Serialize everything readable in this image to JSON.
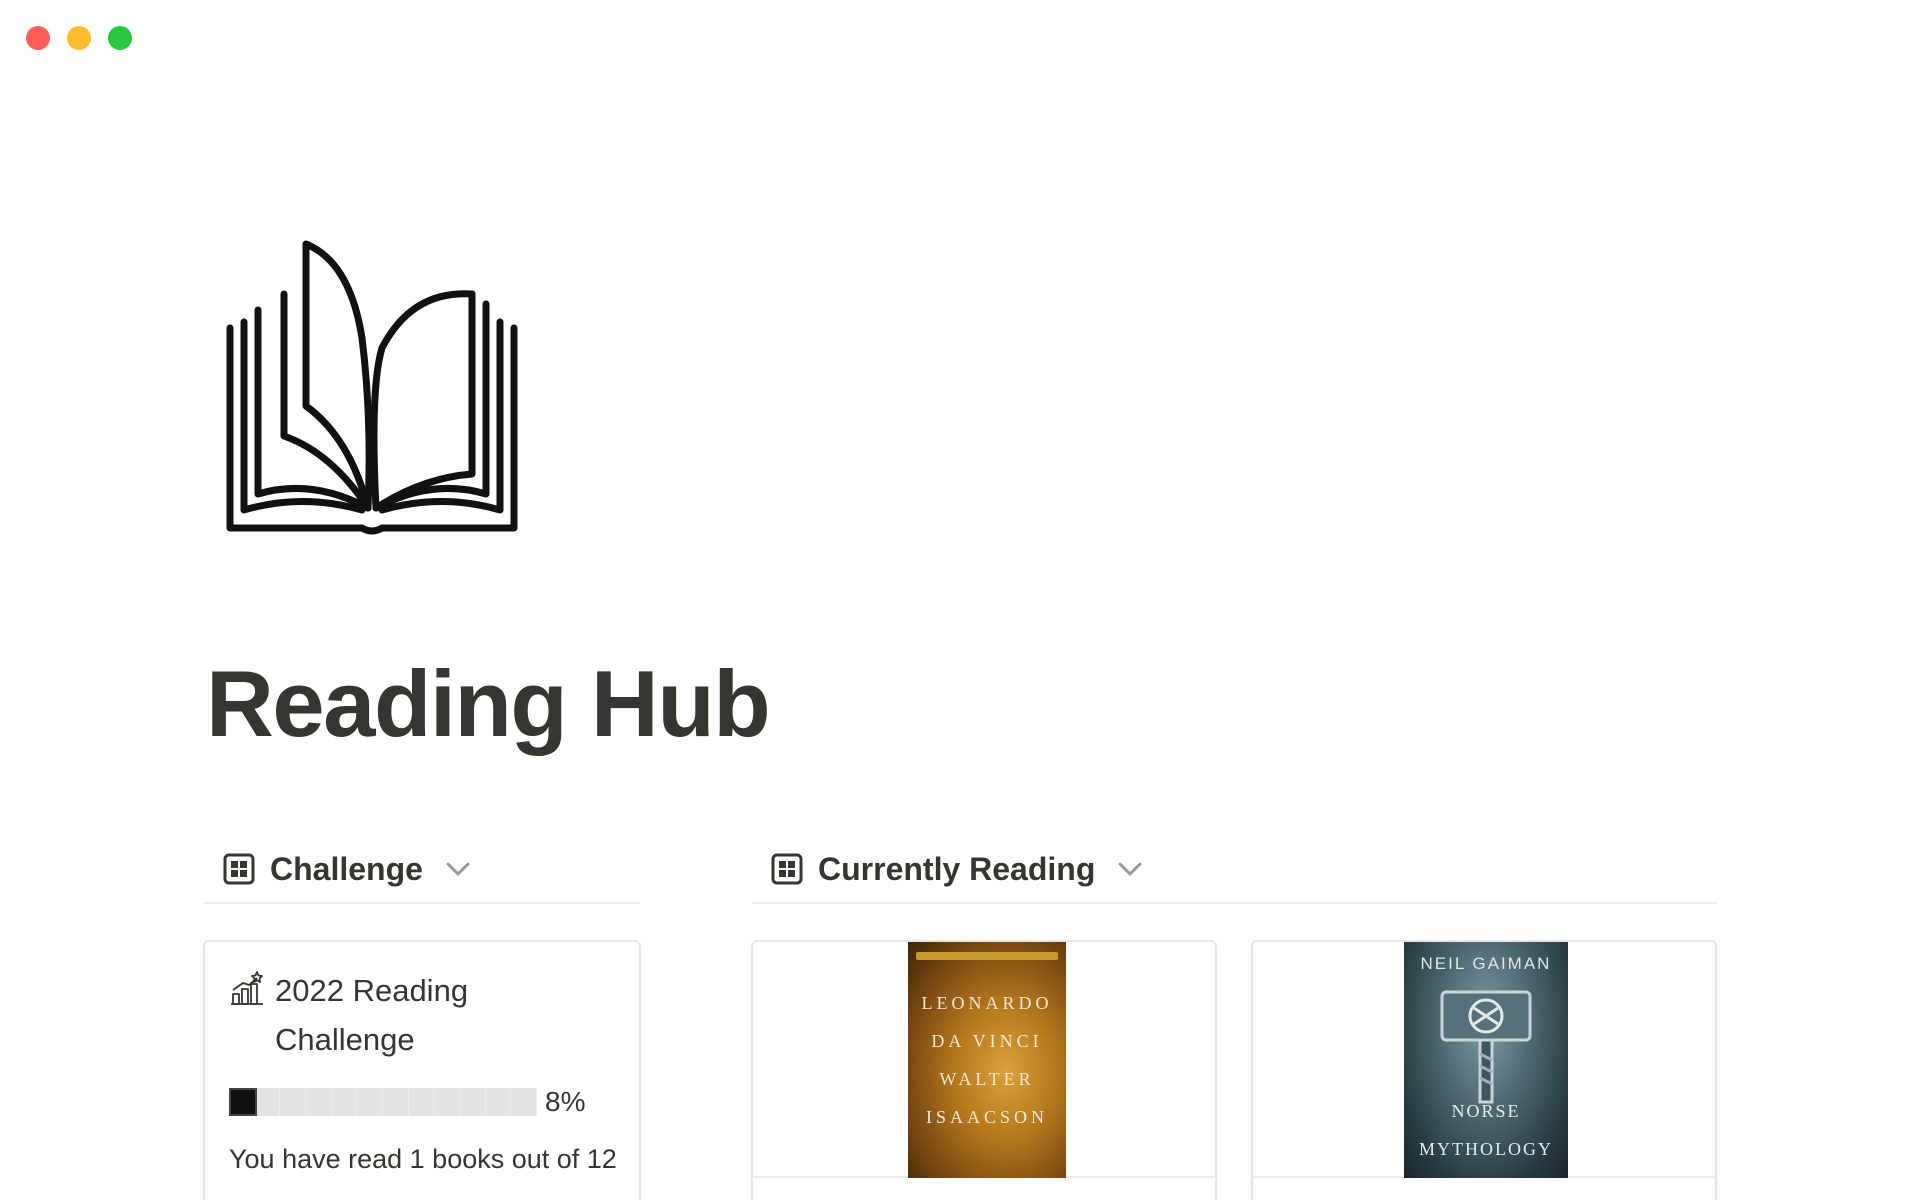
{
  "window": {
    "controls": [
      "close",
      "minimize",
      "maximize"
    ]
  },
  "page": {
    "icon": "open-book-icon",
    "title": "Reading Hub"
  },
  "views": {
    "challenge": {
      "icon": "gallery-view-icon",
      "title": "Challenge"
    },
    "currently_reading": {
      "icon": "gallery-view-icon",
      "title": "Currently Reading"
    }
  },
  "challenge_card": {
    "icon": "growth-chart-icon",
    "title": "2022 Reading Challenge",
    "progress_fraction": 0.08,
    "progress_label": "8%",
    "summary": "You have read 1 books out of 12"
  },
  "books": [
    {
      "cover_lines": [
        "LEONARDO",
        "DA VINCI",
        "WALTER",
        "ISAACSON"
      ]
    },
    {
      "cover_author": "NEIL GAIMAN",
      "cover_title_lines": [
        "NORSE",
        "MYTHOLOGY"
      ]
    }
  ]
}
